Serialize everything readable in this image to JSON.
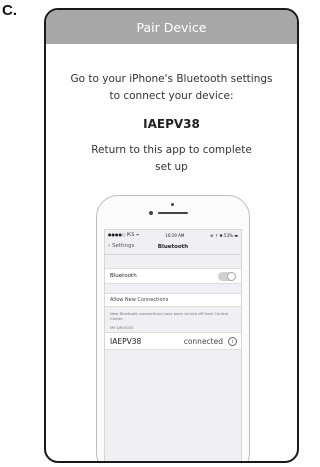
{
  "figure_label": "C.",
  "header": {
    "title": "Pair Device"
  },
  "instructions": {
    "line1": "Go to your iPhone's Bluetooth settings",
    "line2": "to connect your device:",
    "device_id": "IAEPV38",
    "return_line1": "Return to this app to complete",
    "return_line2": "set up"
  },
  "phone": {
    "status_bar": {
      "carrier": "●●●●○ PCS ᯤ",
      "time": "10:19 AM",
      "indicators": "⊕ ↑ ✱ 53% ▬"
    },
    "nav": {
      "back_label": "Settings",
      "back_icon": "chevron-left-icon",
      "title": "Bluetooth"
    },
    "bluetooth_row": {
      "label": "Bluetooth",
      "toggle_on": false
    },
    "allow_row": {
      "label": "Allow New Connections"
    },
    "note": "New Bluetooth connections have been turned off from Control Center.",
    "section_header": "MY DEVICES",
    "devices": [
      {
        "name": "IAEPV38",
        "status": "connected",
        "icon": "info-icon"
      }
    ]
  },
  "colors": {
    "header_bg": "#a7a7a7",
    "header_text": "#ffffff",
    "frame_border": "#1a1a1a",
    "screen_bg": "#efeff4"
  }
}
